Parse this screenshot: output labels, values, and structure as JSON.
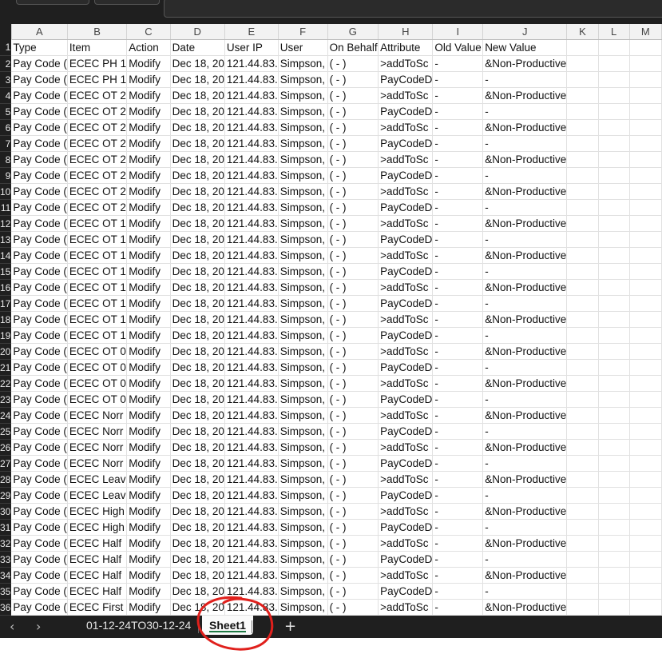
{
  "columns": [
    "A",
    "B",
    "C",
    "D",
    "E",
    "F",
    "G",
    "H",
    "I",
    "J",
    "K",
    "L",
    "M"
  ],
  "header_row": [
    "Type",
    "Item",
    "Action",
    "Date",
    "User IP",
    "User",
    "On Behalf",
    "Attribute",
    "Old Value",
    "New Value",
    "",
    "",
    ""
  ],
  "rows": [
    {
      "n": "2",
      "cells": [
        "Pay Code (",
        "ECEC PH 1",
        "Modify",
        "Dec 18, 20",
        "121.44.83.",
        "Simpson,",
        "( - )",
        ">addToSc",
        "-",
        "&Non-Productive",
        "",
        "",
        ""
      ]
    },
    {
      "n": "3",
      "cells": [
        "Pay Code (",
        "ECEC PH 1",
        "Modify",
        "Dec 18, 20",
        "121.44.83.",
        "Simpson,",
        "( - )",
        "PayCodeD",
        "-",
        "-",
        "",
        "",
        ""
      ]
    },
    {
      "n": "4",
      "cells": [
        "Pay Code (",
        "ECEC OT 2",
        "Modify",
        "Dec 18, 20",
        "121.44.83.",
        "Simpson,",
        "( - )",
        ">addToSc",
        "-",
        "&Non-Productive",
        "",
        "",
        ""
      ]
    },
    {
      "n": "5",
      "cells": [
        "Pay Code (",
        "ECEC OT 2",
        "Modify",
        "Dec 18, 20",
        "121.44.83.",
        "Simpson,",
        "( - )",
        "PayCodeD",
        "-",
        "-",
        "",
        "",
        ""
      ]
    },
    {
      "n": "6",
      "cells": [
        "Pay Code (",
        "ECEC OT 2",
        "Modify",
        "Dec 18, 20",
        "121.44.83.",
        "Simpson,",
        "( - )",
        ">addToSc",
        "-",
        "&Non-Productive",
        "",
        "",
        ""
      ]
    },
    {
      "n": "7",
      "cells": [
        "Pay Code (",
        "ECEC OT 2",
        "Modify",
        "Dec 18, 20",
        "121.44.83.",
        "Simpson,",
        "( - )",
        "PayCodeD",
        "-",
        "-",
        "",
        "",
        ""
      ]
    },
    {
      "n": "8",
      "cells": [
        "Pay Code (",
        "ECEC OT 2",
        "Modify",
        "Dec 18, 20",
        "121.44.83.",
        "Simpson,",
        "( - )",
        ">addToSc",
        "-",
        "&Non-Productive",
        "",
        "",
        ""
      ]
    },
    {
      "n": "9",
      "cells": [
        "Pay Code (",
        "ECEC OT 2",
        "Modify",
        "Dec 18, 20",
        "121.44.83.",
        "Simpson,",
        "( - )",
        "PayCodeD",
        "-",
        "-",
        "",
        "",
        ""
      ]
    },
    {
      "n": "10",
      "cells": [
        "Pay Code (",
        "ECEC OT 2",
        "Modify",
        "Dec 18, 20",
        "121.44.83.",
        "Simpson,",
        "( - )",
        ">addToSc",
        "-",
        "&Non-Productive",
        "",
        "",
        ""
      ]
    },
    {
      "n": "11",
      "cells": [
        "Pay Code (",
        "ECEC OT 2",
        "Modify",
        "Dec 18, 20",
        "121.44.83.",
        "Simpson,",
        "( - )",
        "PayCodeD",
        "-",
        "-",
        "",
        "",
        ""
      ]
    },
    {
      "n": "12",
      "cells": [
        "Pay Code (",
        "ECEC OT 1",
        "Modify",
        "Dec 18, 20",
        "121.44.83.",
        "Simpson,",
        "( - )",
        ">addToSc",
        "-",
        "&Non-Productive",
        "",
        "",
        ""
      ]
    },
    {
      "n": "13",
      "cells": [
        "Pay Code (",
        "ECEC OT 1",
        "Modify",
        "Dec 18, 20",
        "121.44.83.",
        "Simpson,",
        "( - )",
        "PayCodeD",
        "-",
        "-",
        "",
        "",
        ""
      ]
    },
    {
      "n": "14",
      "cells": [
        "Pay Code (",
        "ECEC OT 1",
        "Modify",
        "Dec 18, 20",
        "121.44.83.",
        "Simpson,",
        "( - )",
        ">addToSc",
        "-",
        "&Non-Productive",
        "",
        "",
        ""
      ]
    },
    {
      "n": "15",
      "cells": [
        "Pay Code (",
        "ECEC OT 1",
        "Modify",
        "Dec 18, 20",
        "121.44.83.",
        "Simpson,",
        "( - )",
        "PayCodeD",
        "-",
        "-",
        "",
        "",
        ""
      ]
    },
    {
      "n": "16",
      "cells": [
        "Pay Code (",
        "ECEC OT 1",
        "Modify",
        "Dec 18, 20",
        "121.44.83.",
        "Simpson,",
        "( - )",
        ">addToSc",
        "-",
        "&Non-Productive",
        "",
        "",
        ""
      ]
    },
    {
      "n": "17",
      "cells": [
        "Pay Code (",
        "ECEC OT 1",
        "Modify",
        "Dec 18, 20",
        "121.44.83.",
        "Simpson,",
        "( - )",
        "PayCodeD",
        "-",
        "-",
        "",
        "",
        ""
      ]
    },
    {
      "n": "18",
      "cells": [
        "Pay Code (",
        "ECEC OT 1",
        "Modify",
        "Dec 18, 20",
        "121.44.83.",
        "Simpson,",
        "( - )",
        ">addToSc",
        "-",
        "&Non-Productive",
        "",
        "",
        ""
      ]
    },
    {
      "n": "19",
      "cells": [
        "Pay Code (",
        "ECEC OT 1",
        "Modify",
        "Dec 18, 20",
        "121.44.83.",
        "Simpson,",
        "( - )",
        "PayCodeD",
        "-",
        "-",
        "",
        "",
        ""
      ]
    },
    {
      "n": "20",
      "cells": [
        "Pay Code (",
        "ECEC OT 0",
        "Modify",
        "Dec 18, 20",
        "121.44.83.",
        "Simpson,",
        "( - )",
        ">addToSc",
        "-",
        "&Non-Productive",
        "",
        "",
        ""
      ]
    },
    {
      "n": "21",
      "cells": [
        "Pay Code (",
        "ECEC OT 0",
        "Modify",
        "Dec 18, 20",
        "121.44.83.",
        "Simpson,",
        "( - )",
        "PayCodeD",
        "-",
        "-",
        "",
        "",
        ""
      ]
    },
    {
      "n": "22",
      "cells": [
        "Pay Code (",
        "ECEC OT 0",
        "Modify",
        "Dec 18, 20",
        "121.44.83.",
        "Simpson,",
        "( - )",
        ">addToSc",
        "-",
        "&Non-Productive",
        "",
        "",
        ""
      ]
    },
    {
      "n": "23",
      "cells": [
        "Pay Code (",
        "ECEC OT 0",
        "Modify",
        "Dec 18, 20",
        "121.44.83.",
        "Simpson,",
        "( - )",
        "PayCodeD",
        "-",
        "-",
        "",
        "",
        ""
      ]
    },
    {
      "n": "24",
      "cells": [
        "Pay Code (",
        "ECEC Norr",
        "Modify",
        "Dec 18, 20",
        "121.44.83.",
        "Simpson,",
        "( - )",
        ">addToSc",
        "-",
        "&Non-Productive",
        "",
        "",
        ""
      ]
    },
    {
      "n": "25",
      "cells": [
        "Pay Code (",
        "ECEC Norr",
        "Modify",
        "Dec 18, 20",
        "121.44.83.",
        "Simpson,",
        "( - )",
        "PayCodeD",
        "-",
        "-",
        "",
        "",
        ""
      ]
    },
    {
      "n": "26",
      "cells": [
        "Pay Code (",
        "ECEC Norr",
        "Modify",
        "Dec 18, 20",
        "121.44.83.",
        "Simpson,",
        "( - )",
        ">addToSc",
        "-",
        "&Non-Productive",
        "",
        "",
        ""
      ]
    },
    {
      "n": "27",
      "cells": [
        "Pay Code (",
        "ECEC Norr",
        "Modify",
        "Dec 18, 20",
        "121.44.83.",
        "Simpson,",
        "( - )",
        "PayCodeD",
        "-",
        "-",
        "",
        "",
        ""
      ]
    },
    {
      "n": "28",
      "cells": [
        "Pay Code (",
        "ECEC Leav",
        "Modify",
        "Dec 18, 20",
        "121.44.83.",
        "Simpson,",
        "( - )",
        ">addToSc",
        "-",
        "&Non-Productive",
        "",
        "",
        ""
      ]
    },
    {
      "n": "29",
      "cells": [
        "Pay Code (",
        "ECEC Leav",
        "Modify",
        "Dec 18, 20",
        "121.44.83.",
        "Simpson,",
        "( - )",
        "PayCodeD",
        "-",
        "-",
        "",
        "",
        ""
      ]
    },
    {
      "n": "30",
      "cells": [
        "Pay Code (",
        "ECEC High",
        "Modify",
        "Dec 18, 20",
        "121.44.83.",
        "Simpson,",
        "( - )",
        ">addToSc",
        "-",
        "&Non-Productive",
        "",
        "",
        ""
      ]
    },
    {
      "n": "31",
      "cells": [
        "Pay Code (",
        "ECEC High",
        "Modify",
        "Dec 18, 20",
        "121.44.83.",
        "Simpson,",
        "( - )",
        "PayCodeD",
        "-",
        "-",
        "",
        "",
        ""
      ]
    },
    {
      "n": "32",
      "cells": [
        "Pay Code (",
        "ECEC Half",
        "Modify",
        "Dec 18, 20",
        "121.44.83.",
        "Simpson,",
        "( - )",
        ">addToSc",
        "-",
        "&Non-Productive",
        "",
        "",
        ""
      ]
    },
    {
      "n": "33",
      "cells": [
        "Pay Code (",
        "ECEC Half",
        "Modify",
        "Dec 18, 20",
        "121.44.83.",
        "Simpson,",
        "( - )",
        "PayCodeD",
        "-",
        "-",
        "",
        "",
        ""
      ]
    },
    {
      "n": "34",
      "cells": [
        "Pay Code (",
        "ECEC Half",
        "Modify",
        "Dec 18, 20",
        "121.44.83.",
        "Simpson,",
        "( - )",
        ">addToSc",
        "-",
        "&Non-Productive",
        "",
        "",
        ""
      ]
    },
    {
      "n": "35",
      "cells": [
        "Pay Code (",
        "ECEC Half",
        "Modify",
        "Dec 18, 20",
        "121.44.83.",
        "Simpson,",
        "( - )",
        "PayCodeD",
        "-",
        "-",
        "",
        "",
        ""
      ]
    },
    {
      "n": "36",
      "cells": [
        "Pay Code (",
        "ECEC First",
        "Modify",
        "Dec 18, 20",
        "121.44.83.",
        "Simpson,",
        "( - )",
        ">addToSc",
        "-",
        "&Non-Productive",
        "",
        "",
        ""
      ]
    }
  ],
  "sheet_tabs": [
    {
      "label": "01-12-24TO30-12-24",
      "active": false
    },
    {
      "label": "Sheet1",
      "active": true
    }
  ],
  "nav": {
    "prev": "‹",
    "next": "›",
    "add": "+"
  },
  "icons": {
    "prev": "chevron-left-icon",
    "next": "chevron-right-icon",
    "add": "plus-icon"
  },
  "colors": {
    "accent": "#1f7a44",
    "annotation": "#e0201c",
    "chrome": "#1f1f1f"
  }
}
